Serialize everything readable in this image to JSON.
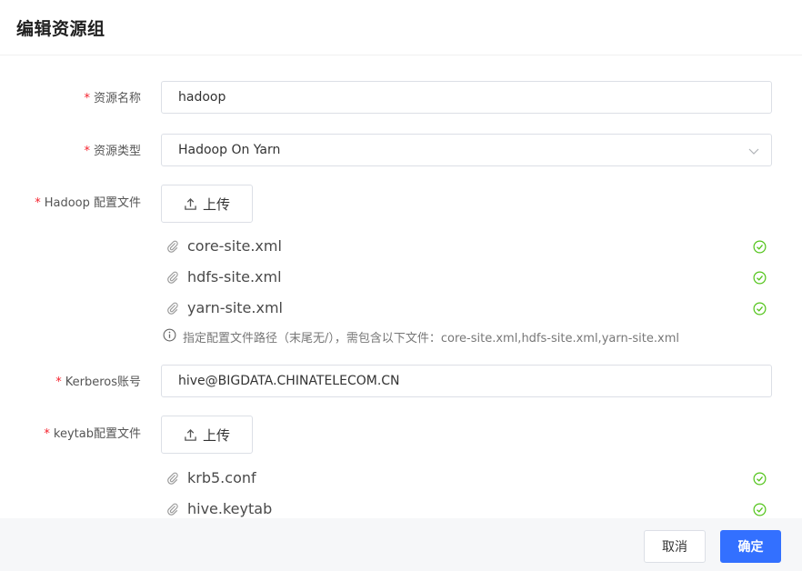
{
  "dialog": {
    "title": "编辑资源组"
  },
  "form": {
    "name": {
      "label": "资源名称",
      "value": "hadoop"
    },
    "type": {
      "label": "资源类型",
      "value": "Hadoop On Yarn"
    },
    "hadoop_config": {
      "label": "Hadoop 配置文件",
      "upload_label": "上传",
      "files": [
        "core-site.xml",
        "hdfs-site.xml",
        "yarn-site.xml"
      ],
      "hint": "指定配置文件路径（末尾无/），需包含以下文件：core-site.xml,hdfs-site.xml,yarn-site.xml"
    },
    "kerberos": {
      "label": "Kerberos账号",
      "value": "hive@BIGDATA.CHINATELECOM.CN"
    },
    "keytab_config": {
      "label": "keytab配置文件",
      "upload_label": "上传",
      "files": [
        "krb5.conf",
        "hive.keytab"
      ]
    },
    "required_mark": "*"
  },
  "footer": {
    "cancel_label": "取消",
    "ok_label": "确定"
  },
  "colors": {
    "primary": "#3370ff",
    "required": "#f5222d",
    "success": "#52c41a"
  },
  "icons": {
    "upload": "upload-icon",
    "attachment": "paperclip-icon",
    "success": "check-circle-icon",
    "info": "info-circle-icon",
    "dropdown": "chevron-down-icon"
  }
}
